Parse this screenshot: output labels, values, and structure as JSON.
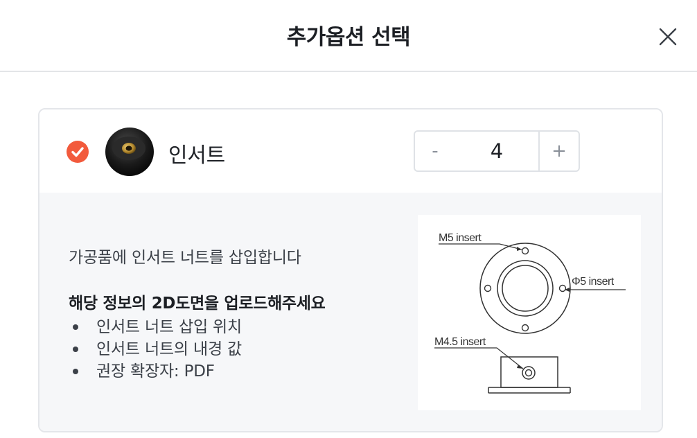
{
  "header": {
    "title": "추가옵션 선택",
    "close_icon": "close-icon"
  },
  "option": {
    "checked": true,
    "check_color": "#f25a3c",
    "name": "인서트",
    "quantity": {
      "minus_label": "-",
      "value": "4",
      "plus_label": "+"
    }
  },
  "details": {
    "description": "가공품에 인서트 너트를 삽입합니다",
    "upload_heading": "해당 정보의 2D도면을 업로드해주세요",
    "requirements": [
      "인서트 너트 삽입 위치",
      "인서트 너트의 내경 값",
      "권장 확장자: PDF"
    ]
  },
  "diagram": {
    "label_m5": "M5 insert",
    "label_phi5": "Φ5 insert",
    "label_m45": "M4.5 insert"
  }
}
